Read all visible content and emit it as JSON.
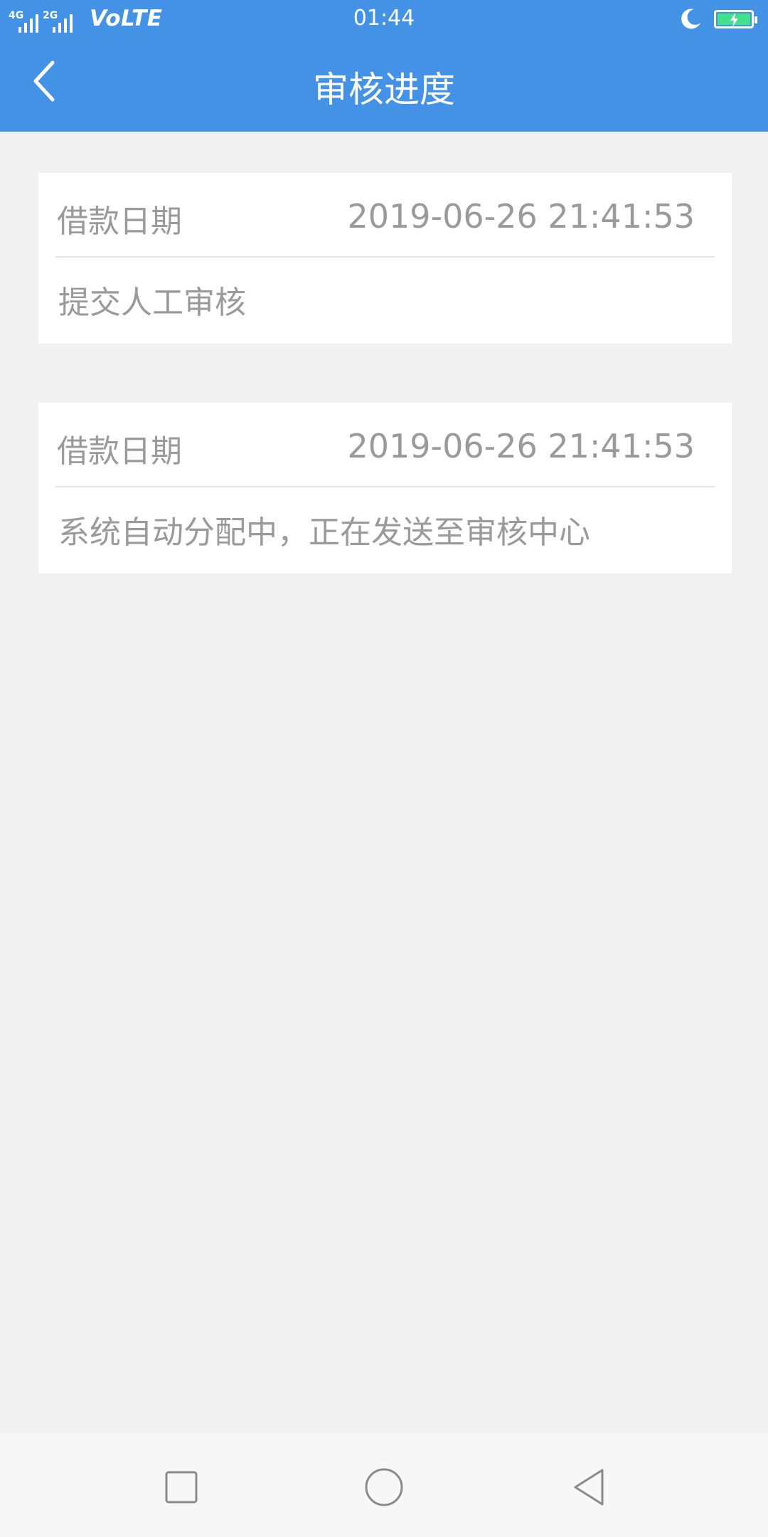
{
  "status_bar": {
    "network_1": "4G",
    "network_2": "2G",
    "volte": "VoLTE",
    "time": "01:44",
    "icons": [
      "signal-icon",
      "moon-icon",
      "battery-icon"
    ]
  },
  "app_bar": {
    "title": "审核进度",
    "back_icon": "chevron-left-icon"
  },
  "records": [
    {
      "label": "借款日期",
      "datetime": "2019-06-26 21:41:53",
      "status": "提交人工审核"
    },
    {
      "label": "借款日期",
      "datetime": "2019-06-26 21:41:53",
      "status": "系统自动分配中，正在发送至审核中心"
    }
  ],
  "nav_bar": {
    "icons": [
      "recent-apps-icon",
      "home-icon",
      "back-triangle-icon"
    ]
  },
  "colors": {
    "header_bg": "#4492e6",
    "page_bg": "#f1f1f1",
    "card_bg": "#ffffff",
    "text_gray": "#9a9a9a",
    "battery_fill": "#41e28b"
  }
}
